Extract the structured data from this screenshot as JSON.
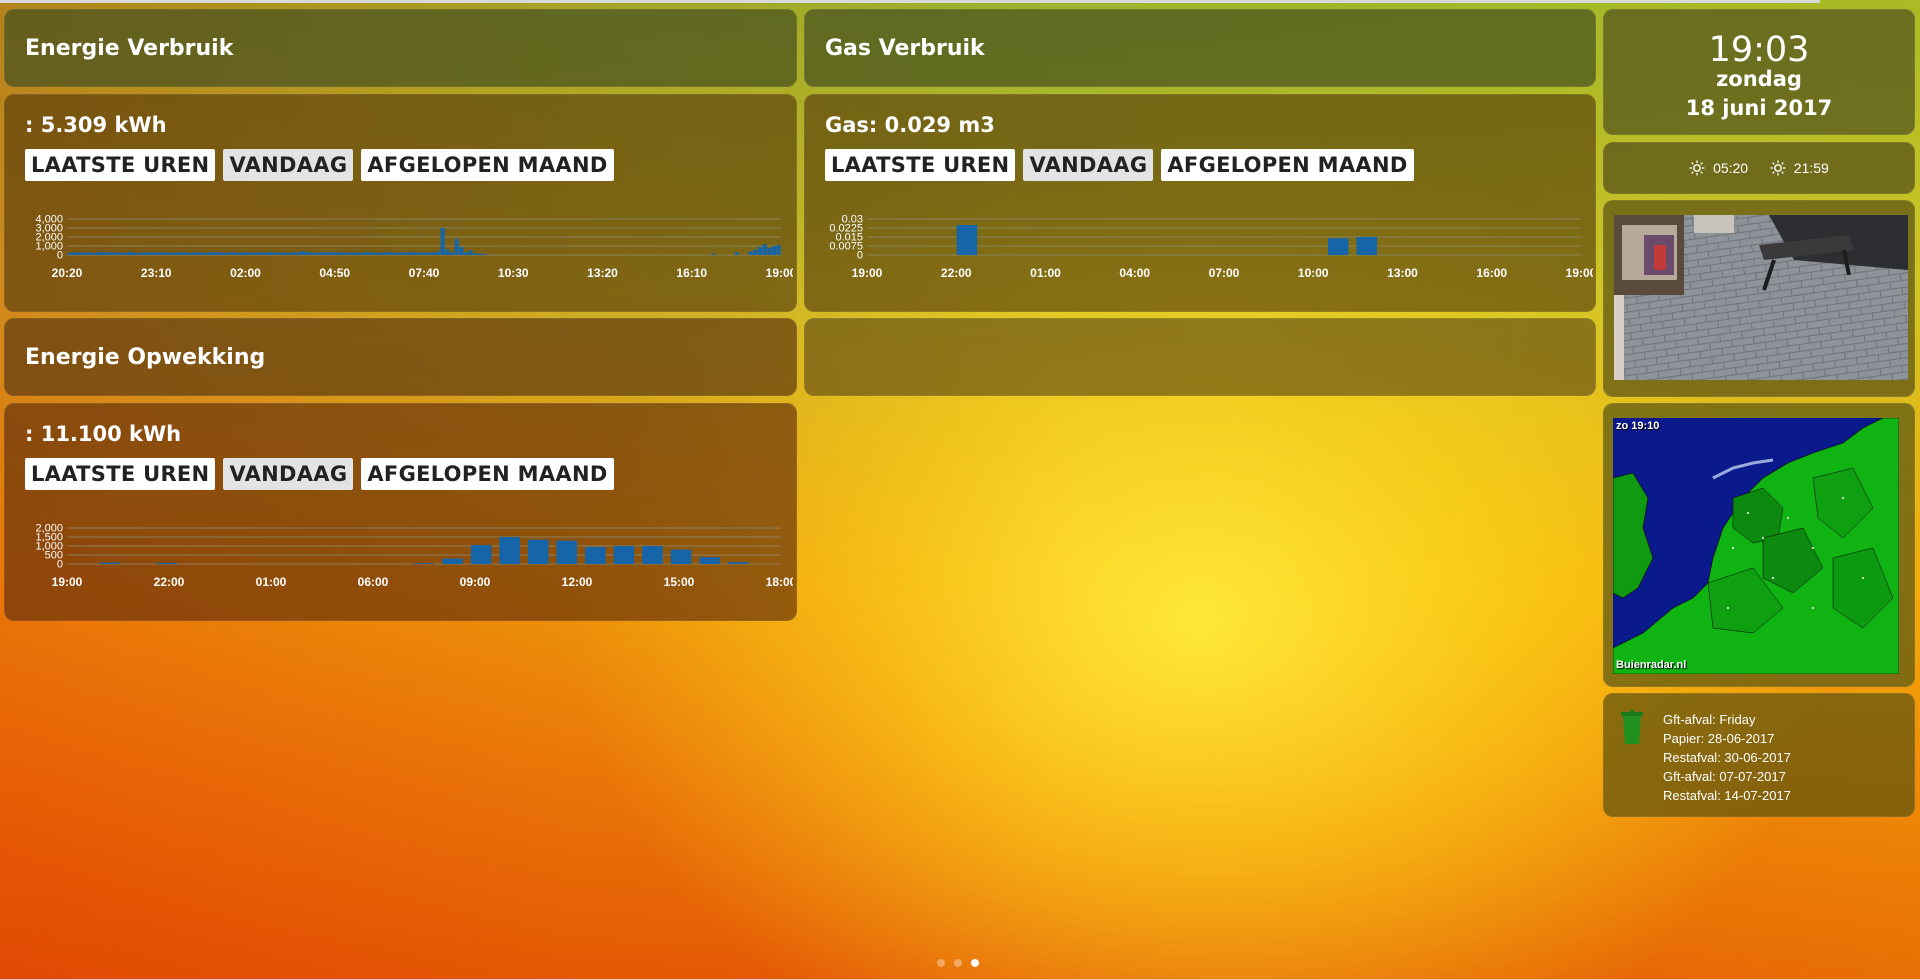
{
  "colors": {
    "bar": "#1565a8",
    "grid": "#8c8c70"
  },
  "energy": {
    "title": "Energie Verbruik",
    "reading": ": 5.309 kWh",
    "buttons": [
      "LAATSTE UREN",
      "VANDAAG",
      "AFGELOPEN MAAND"
    ],
    "active_button": "VANDAAG"
  },
  "gas": {
    "title": "Gas Verbruik",
    "reading": "Gas: 0.029 m3",
    "buttons": [
      "LAATSTE UREN",
      "VANDAAG",
      "AFGELOPEN MAAND"
    ],
    "active_button": "VANDAAG"
  },
  "solar": {
    "title": "Energie Opwekking",
    "reading": ": 11.100 kWh",
    "buttons": [
      "LAATSTE UREN",
      "VANDAAG",
      "AFGELOPEN MAAND"
    ],
    "active_button": "VANDAAG"
  },
  "clock": {
    "time": "19:03",
    "day": "zondag",
    "date": "18 juni 2017"
  },
  "sun": {
    "sunrise": "05:20",
    "sunset": "21:59",
    "icon": "sun-icon"
  },
  "radar": {
    "time": "zo 19:10",
    "brand": "Buienradar.nl"
  },
  "waste": {
    "icon": "trash-bin-icon",
    "items": [
      "Gft-afval: Friday",
      "Papier: 28-06-2017",
      "Restafval: 30-06-2017",
      "Gft-afval: 07-07-2017",
      "Restafval: 14-07-2017"
    ]
  },
  "pager": {
    "count": 3,
    "active": 3
  },
  "chart_data": [
    {
      "id": "energy-usage",
      "type": "bar",
      "ylim": [
        0,
        4000
      ],
      "y_ticks": [
        "4,000",
        "3,000",
        "2,000",
        "1,000",
        "0"
      ],
      "x_ticks": [
        "20:20",
        "23:10",
        "02:00",
        "04:50",
        "07:40",
        "10:30",
        "13:20",
        "16:10",
        "19:00"
      ],
      "values": [
        250,
        300,
        320,
        280,
        310,
        260,
        300,
        330,
        290,
        310,
        280,
        300,
        270,
        320,
        300,
        260,
        310,
        290,
        330,
        280,
        300,
        310,
        270,
        290,
        320,
        300,
        260,
        310,
        300,
        280,
        290,
        330,
        310,
        270,
        300,
        320,
        290,
        280,
        310,
        300,
        270,
        320,
        290,
        300,
        310,
        280,
        300,
        260,
        320,
        300,
        450,
        350,
        300,
        280,
        310,
        290,
        300,
        320,
        300,
        280,
        310,
        290,
        270,
        300,
        320,
        290,
        300,
        260,
        350,
        300,
        280,
        290,
        310,
        300,
        330,
        290,
        280,
        300,
        310,
        400,
        3000,
        600,
        300,
        1800,
        900,
        300,
        500,
        200,
        150,
        120,
        0,
        0,
        0,
        0,
        0,
        0,
        0,
        0,
        0,
        0,
        0,
        0,
        0,
        0,
        0,
        0,
        0,
        0,
        0,
        0,
        0,
        0,
        0,
        0,
        0,
        0,
        0,
        0,
        0,
        0,
        0,
        0,
        0,
        0,
        0,
        0,
        0,
        0,
        0,
        0,
        0,
        0,
        0,
        0,
        0,
        0,
        0,
        0,
        150,
        0,
        0,
        0,
        0,
        300,
        0,
        0,
        400,
        600,
        900,
        1200,
        800,
        1000,
        1100
      ]
    },
    {
      "id": "gas-usage",
      "type": "bar",
      "ylim": [
        0,
        0.03
      ],
      "y_ticks": [
        "0.03",
        "0.0225",
        "0.015",
        "0.0075",
        "0"
      ],
      "x_ticks": [
        "19:00",
        "22:00",
        "01:00",
        "04:00",
        "07:00",
        "10:00",
        "13:00",
        "16:00",
        "19:00"
      ],
      "categories": [
        "19:00",
        "20:00",
        "21:00",
        "22:00",
        "23:00",
        "00:00",
        "01:00",
        "02:00",
        "03:00",
        "04:00",
        "05:00",
        "06:00",
        "07:00",
        "08:00",
        "09:00",
        "10:00",
        "11:00",
        "12:00",
        "13:00",
        "14:00",
        "15:00",
        "16:00",
        "17:00",
        "18:00",
        "19:00"
      ],
      "values": [
        0,
        0,
        0,
        0.025,
        0,
        0,
        0,
        0,
        0,
        0,
        0,
        0,
        0,
        0,
        0,
        0,
        0.014,
        0.015,
        0,
        0,
        0,
        0,
        0,
        0,
        0
      ]
    },
    {
      "id": "solar-production",
      "type": "bar",
      "ylim": [
        0,
        2000
      ],
      "y_ticks": [
        "2,000",
        "1,500",
        "1,000",
        "500",
        "0"
      ],
      "x_ticks": [
        "19:00",
        "22:00",
        "01:00",
        "06:00",
        "09:00",
        "12:00",
        "15:00",
        "18:00"
      ],
      "categories": [
        "19:00",
        "20:00",
        "21:00",
        "22:00",
        "23:00",
        "00:00",
        "01:00",
        "02:00",
        "03:00",
        "04:00",
        "05:00",
        "06:00",
        "07:00",
        "08:00",
        "09:00",
        "10:00",
        "11:00",
        "12:00",
        "13:00",
        "14:00",
        "15:00",
        "16:00",
        "17:00",
        "18:00",
        "19:00"
      ],
      "values": [
        0,
        80,
        0,
        60,
        0,
        0,
        0,
        0,
        0,
        0,
        0,
        0,
        40,
        300,
        1050,
        1500,
        1350,
        1300,
        950,
        1000,
        1000,
        800,
        380,
        100,
        0
      ]
    }
  ]
}
